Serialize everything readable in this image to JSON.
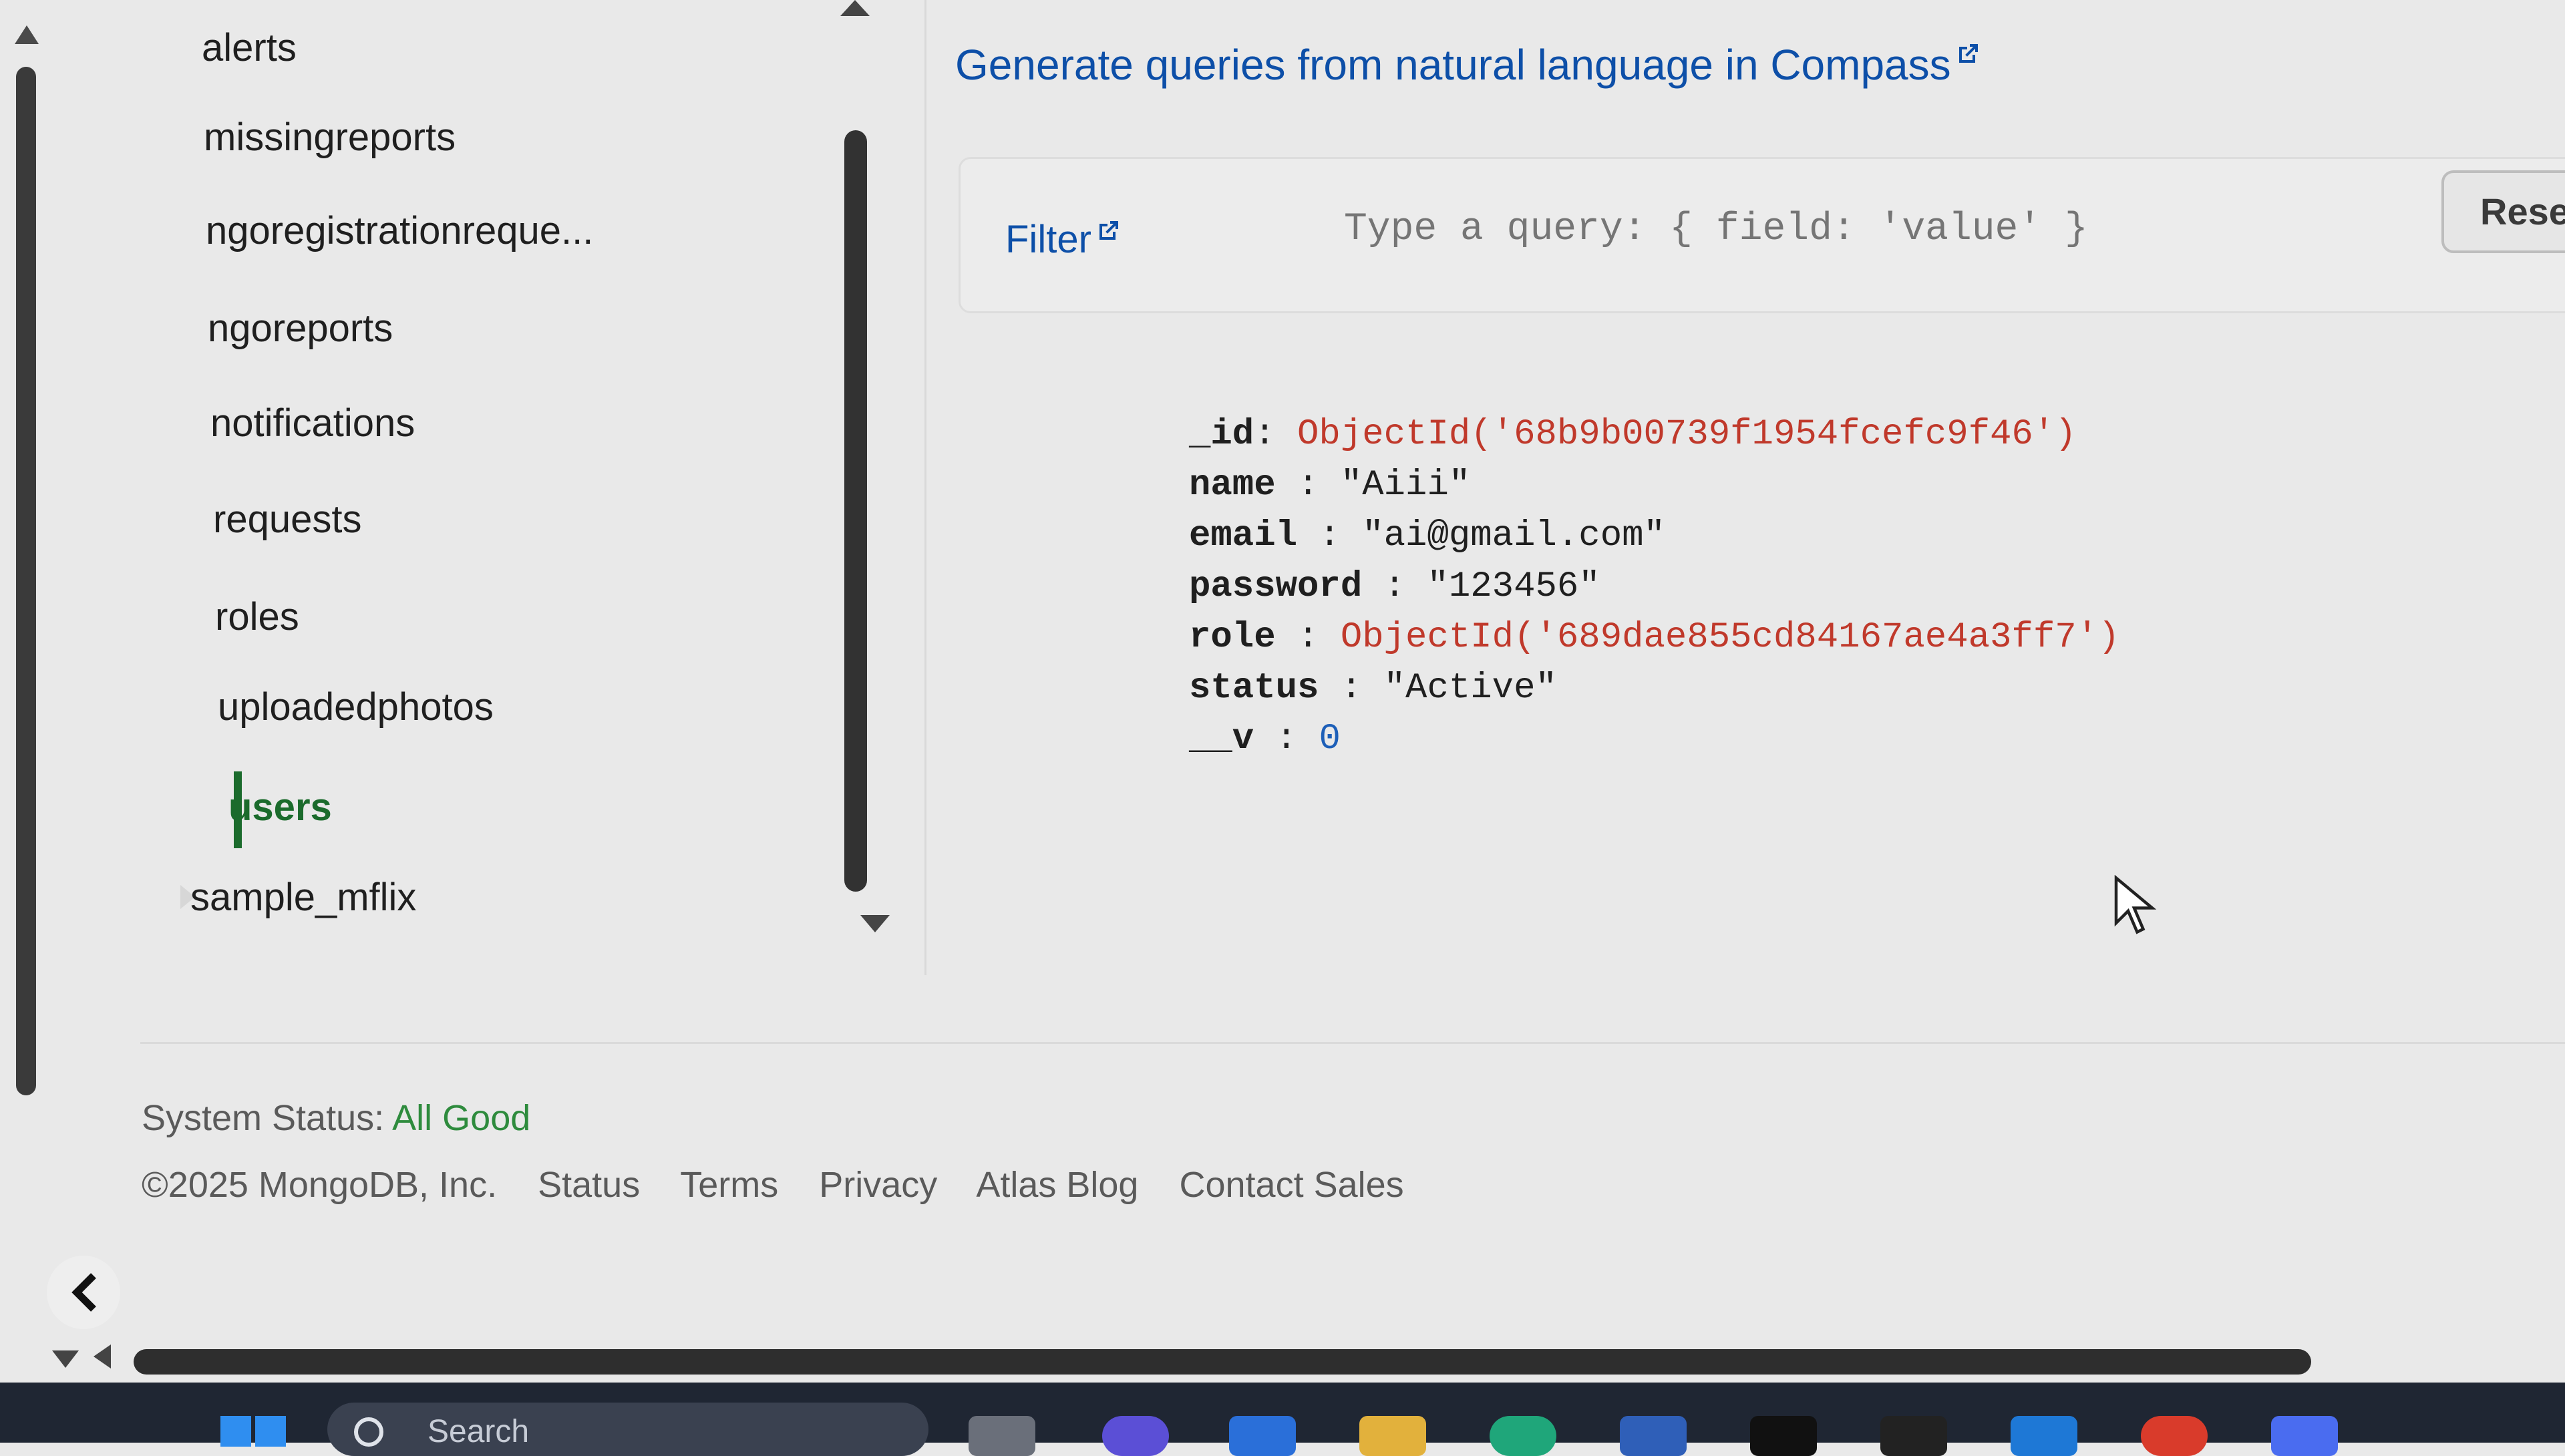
{
  "sidebar": {
    "collections": [
      {
        "label": "alerts"
      },
      {
        "label": "missingreports"
      },
      {
        "label": "ngoregistrationreque..."
      },
      {
        "label": "ngoreports"
      },
      {
        "label": "notifications"
      },
      {
        "label": "requests"
      },
      {
        "label": "roles"
      },
      {
        "label": "uploadedphotos"
      },
      {
        "label": "users",
        "active": true
      }
    ],
    "database_next": "sample_mflix"
  },
  "main": {
    "nl_link": "Generate queries from natural language in Compass",
    "filter": {
      "label": "Filter",
      "placeholder": "Type a query: { field: 'value' }",
      "reset_label": "Reset"
    },
    "document": [
      {
        "key": "_id",
        "sep": ": ",
        "value": "ObjectId('68b9b00739f1954fcefc9f46')",
        "kind": "oid"
      },
      {
        "key": "name",
        "sep": " : ",
        "value": "\"Aiii\"",
        "kind": "str"
      },
      {
        "key": "email",
        "sep": " : ",
        "value": "\"ai@gmail.com\"",
        "kind": "str"
      },
      {
        "key": "password",
        "sep": " : ",
        "value": "\"123456\"",
        "kind": "str"
      },
      {
        "key": "role",
        "sep": " : ",
        "value": "ObjectId('689dae855cd84167ae4a3ff7')",
        "kind": "oid"
      },
      {
        "key": "status",
        "sep": " : ",
        "value": "\"Active\"",
        "kind": "str"
      },
      {
        "key": "__v",
        "sep": " : ",
        "value": "0",
        "kind": "num"
      }
    ]
  },
  "footer": {
    "status_label": "System Status: ",
    "status_value": "All Good",
    "copyright": "©2025 MongoDB, Inc.",
    "links": [
      "Status",
      "Terms",
      "Privacy",
      "Atlas Blog",
      "Contact Sales"
    ]
  },
  "taskbar": {
    "search_placeholder": "Search"
  },
  "colors": {
    "accent_green": "#1b6b2c",
    "link_blue": "#0d4fa8",
    "objectid_red": "#c0392b",
    "number_blue": "#1d5fb8",
    "status_good": "#2e8b3d"
  }
}
